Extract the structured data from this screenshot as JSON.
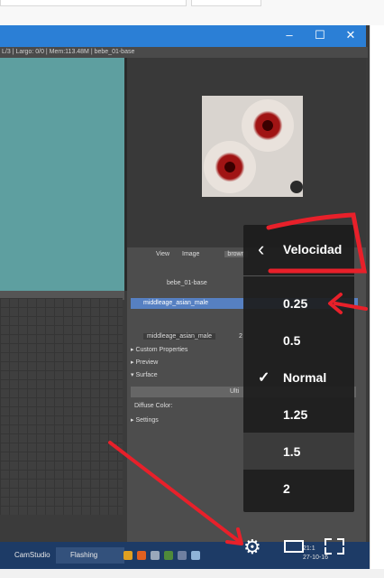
{
  "window": {
    "info_text": "L/3 | Largo: 0/0 | Mem:113.48M | bebe_01-base",
    "controls": [
      "–",
      "☐",
      "✕"
    ]
  },
  "image_editor": {
    "header_items": [
      "View",
      "Image",
      "brown"
    ]
  },
  "properties": {
    "material_owner": "bebe_01-base",
    "material_slot": "middleage_asian_male",
    "material_name": "middleage_asian_male",
    "material_users": "2",
    "sections": [
      "Custom Properties",
      "Preview",
      "Surface",
      "Settings"
    ],
    "diffuse_label": "Diffuse Color:",
    "bsdf_value": "Ulti"
  },
  "taskbar": {
    "items": [
      "CamStudio",
      "Flashing"
    ],
    "time": "21:1",
    "date": "27-10-16"
  },
  "speed_menu": {
    "title": "Velocidad",
    "options": [
      "0.25",
      "0.5",
      "Normal",
      "1.25",
      "1.5",
      "2"
    ],
    "selected": "Normal",
    "highlighted": "1.5"
  },
  "player_controls": {
    "settings_icon": "gear-icon",
    "theater_icon": "theater-mode-icon",
    "fullscreen_icon": "fullscreen-icon"
  },
  "colors": {
    "annotation_red": "#e8202a",
    "menu_bg": "#1c1c1c",
    "viewport_teal": "#5e9fa0",
    "titlebar_blue": "#2b7fd6",
    "taskbar_blue": "#1d3b66"
  }
}
